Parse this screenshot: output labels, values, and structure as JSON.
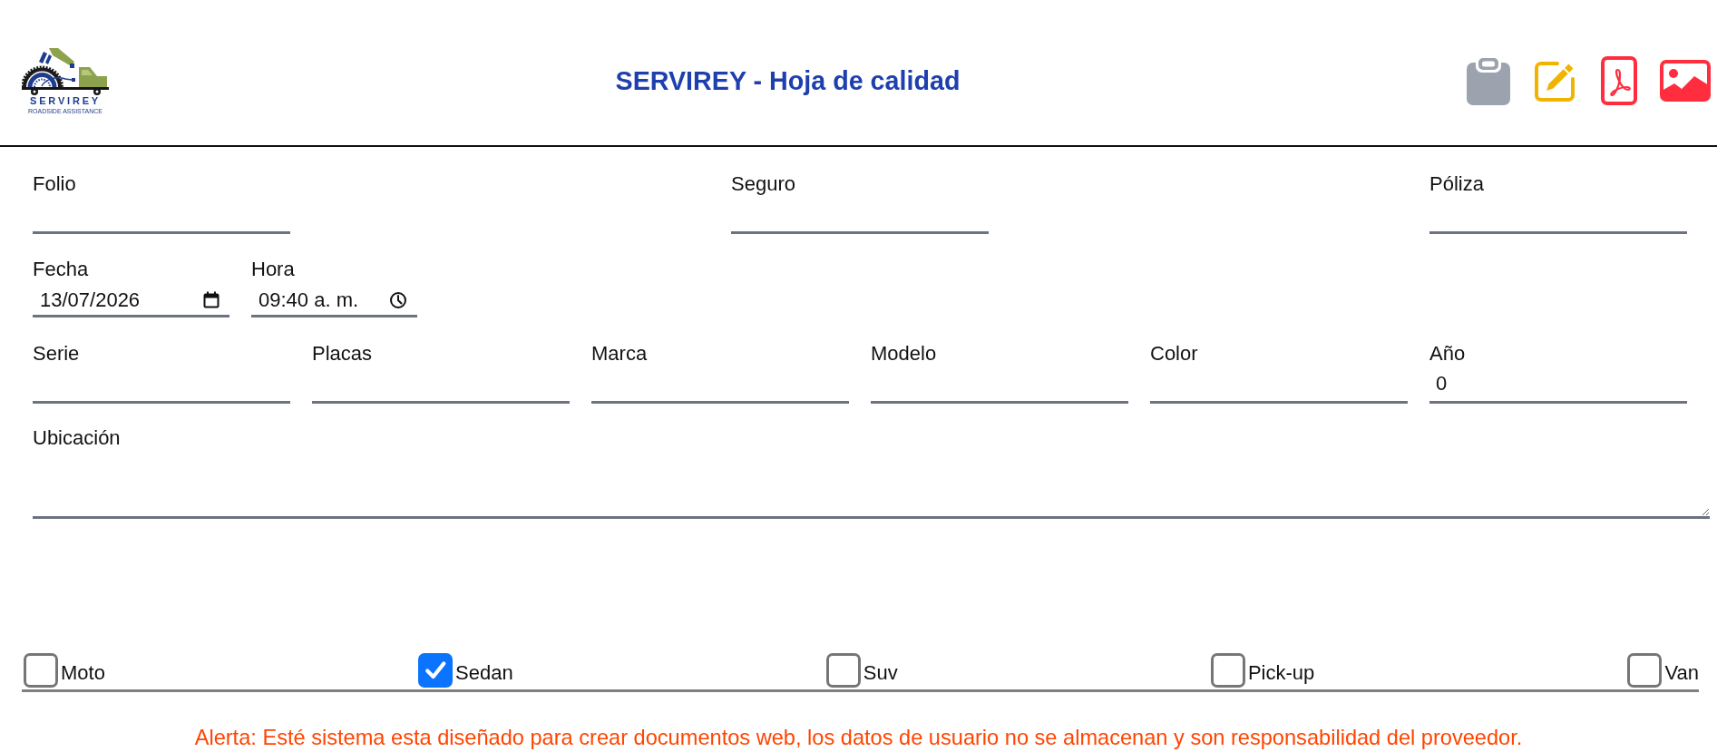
{
  "header": {
    "logo": {
      "name": "SERVIREY",
      "tagline": "ROADSIDE ASSISTANCE"
    },
    "title": "SERVIREY - Hoja de calidad"
  },
  "form": {
    "top_fields": [
      {
        "label": "Folio"
      },
      {
        "label": "Seguro"
      },
      {
        "label": "Póliza"
      }
    ],
    "datetime_fields": [
      {
        "label": "Fecha",
        "kind": "date",
        "value": "13/07/2026"
      },
      {
        "label": "Hora",
        "kind": "time",
        "value": "09:40 a. m."
      }
    ],
    "vehicle_fields": [
      {
        "label": "Serie"
      },
      {
        "label": "Placas"
      },
      {
        "label": "Marca"
      },
      {
        "label": "Modelo"
      },
      {
        "label": "Color"
      },
      {
        "label": "Año",
        "value": "0"
      }
    ],
    "location_field": {
      "label": "Ubicación"
    }
  },
  "vehicle_types": [
    {
      "label": "Moto",
      "checked": false
    },
    {
      "label": "Sedan",
      "checked": true
    },
    {
      "label": "Suv",
      "checked": false
    },
    {
      "label": "Pick-up",
      "checked": false
    },
    {
      "label": "Van",
      "checked": false
    }
  ],
  "alert": "Alerta: Esté sistema esta diseñado para crear documentos web, los datos de usuario no se almacenan y son responsabilidad del proveedor."
}
